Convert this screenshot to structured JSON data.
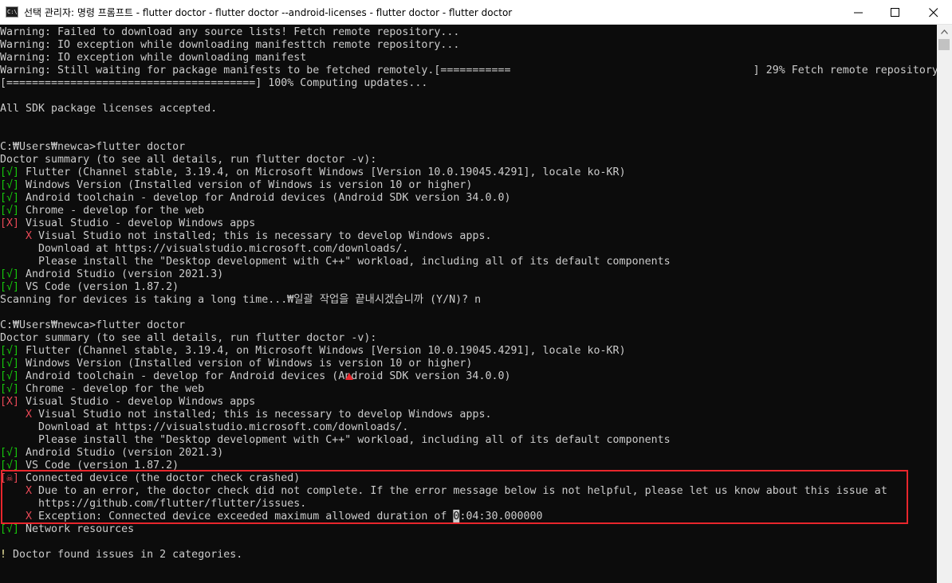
{
  "window": {
    "title": "선택 관리자: 명령 프롬프트 - flutter  doctor - flutter  doctor --android-licenses - flutter  doctor - flutter  doctor",
    "app_icon_text": "C:\\"
  },
  "lines": [
    {
      "segs": [
        {
          "t": "Warning: Failed to download any source lists! Fetch remote repository...",
          "c": ""
        }
      ]
    },
    {
      "segs": [
        {
          "t": "Warning: IO exception while downloading manifesttch remote repository...",
          "c": ""
        }
      ]
    },
    {
      "segs": [
        {
          "t": "Warning: IO exception while downloading manifest",
          "c": ""
        }
      ]
    },
    {
      "segs": [
        {
          "t": "Warning: Still waiting for package manifests to be fetched remotely.[===========                                      ] 29% Fetch remote repository...",
          "c": ""
        }
      ]
    },
    {
      "segs": [
        {
          "t": "[=======================================] 100% Computing updates...",
          "c": ""
        }
      ]
    },
    {
      "segs": []
    },
    {
      "segs": [
        {
          "t": "All SDK package licenses accepted.",
          "c": ""
        }
      ]
    },
    {
      "segs": []
    },
    {
      "segs": []
    },
    {
      "segs": [
        {
          "t": "C:₩Users₩newca>flutter doctor",
          "c": ""
        }
      ]
    },
    {
      "segs": [
        {
          "t": "Doctor summary (to see all details, run flutter doctor -v):",
          "c": ""
        }
      ]
    },
    {
      "segs": [
        {
          "t": "[√]",
          "c": "g"
        },
        {
          "t": " Flutter (Channel stable, 3.19.4, on Microsoft Windows [Version 10.0.19045.4291], locale ko-KR)",
          "c": ""
        }
      ]
    },
    {
      "segs": [
        {
          "t": "[√]",
          "c": "g"
        },
        {
          "t": " Windows Version (Installed version of Windows is version 10 or higher)",
          "c": ""
        }
      ]
    },
    {
      "segs": [
        {
          "t": "[√]",
          "c": "g"
        },
        {
          "t": " Android toolchain - develop for Android devices (Android SDK version 34.0.0)",
          "c": ""
        }
      ]
    },
    {
      "segs": [
        {
          "t": "[√]",
          "c": "g"
        },
        {
          "t": " Chrome - develop for the web",
          "c": ""
        }
      ]
    },
    {
      "segs": [
        {
          "t": "[X]",
          "c": "r"
        },
        {
          "t": " Visual Studio - develop Windows apps",
          "c": ""
        }
      ]
    },
    {
      "segs": [
        {
          "t": "    ",
          "c": ""
        },
        {
          "t": "X",
          "c": "r"
        },
        {
          "t": " Visual Studio not installed; this is necessary to develop Windows apps.",
          "c": ""
        }
      ]
    },
    {
      "segs": [
        {
          "t": "      Download at https://visualstudio.microsoft.com/downloads/.",
          "c": ""
        }
      ]
    },
    {
      "segs": [
        {
          "t": "      Please install the \"Desktop development with C++\" workload, including all of its default components",
          "c": ""
        }
      ]
    },
    {
      "segs": [
        {
          "t": "[√]",
          "c": "g"
        },
        {
          "t": " Android Studio (version 2021.3)",
          "c": ""
        }
      ]
    },
    {
      "segs": [
        {
          "t": "[√]",
          "c": "g"
        },
        {
          "t": " VS Code (version 1.87.2)",
          "c": ""
        }
      ]
    },
    {
      "segs": [
        {
          "t": "Scanning for devices is taking a long time...₩일괄 작업을 끝내시겠습니까 (Y/N)? n",
          "c": ""
        }
      ]
    },
    {
      "segs": []
    },
    {
      "segs": [
        {
          "t": "C:₩Users₩newca>flutter doctor",
          "c": ""
        }
      ]
    },
    {
      "segs": [
        {
          "t": "Doctor summary (to see all details, run flutter doctor -v):",
          "c": ""
        }
      ]
    },
    {
      "segs": [
        {
          "t": "[√]",
          "c": "g"
        },
        {
          "t": " Flutter (Channel stable, 3.19.4, on Microsoft Windows [Version 10.0.19045.4291], locale ko-KR)",
          "c": ""
        }
      ]
    },
    {
      "segs": [
        {
          "t": "[√]",
          "c": "g"
        },
        {
          "t": " Windows Version (Installed version of Windows is version 10 or higher)",
          "c": ""
        }
      ]
    },
    {
      "segs": [
        {
          "t": "[√]",
          "c": "g"
        },
        {
          "t": " Android toolchain - develop for Android devices (Android SDK version 34.0.0)",
          "c": ""
        }
      ]
    },
    {
      "segs": [
        {
          "t": "[√]",
          "c": "g"
        },
        {
          "t": " Chrome - develop for the web",
          "c": ""
        }
      ]
    },
    {
      "segs": [
        {
          "t": "[X]",
          "c": "r"
        },
        {
          "t": " Visual Studio - develop Windows apps",
          "c": ""
        }
      ]
    },
    {
      "segs": [
        {
          "t": "    ",
          "c": ""
        },
        {
          "t": "X",
          "c": "r"
        },
        {
          "t": " Visual Studio not installed; this is necessary to develop Windows apps.",
          "c": ""
        }
      ]
    },
    {
      "segs": [
        {
          "t": "      Download at https://visualstudio.microsoft.com/downloads/.",
          "c": ""
        }
      ]
    },
    {
      "segs": [
        {
          "t": "      Please install the \"Desktop development with C++\" workload, including all of its default components",
          "c": ""
        }
      ]
    },
    {
      "segs": [
        {
          "t": "[√]",
          "c": "g"
        },
        {
          "t": " Android Studio (version 2021.3)",
          "c": ""
        }
      ]
    },
    {
      "segs": [
        {
          "t": "[√]",
          "c": "g"
        },
        {
          "t": " VS Code (version 1.87.2)",
          "c": ""
        }
      ]
    },
    {
      "segs": [
        {
          "t": "[☠]",
          "c": "r"
        },
        {
          "t": " Connected device (the doctor check crashed)",
          "c": ""
        }
      ]
    },
    {
      "segs": [
        {
          "t": "    ",
          "c": ""
        },
        {
          "t": "X",
          "c": "r"
        },
        {
          "t": " Due to an error, the doctor check did not complete. If the error message below is not helpful, please let us know about this issue at",
          "c": ""
        }
      ]
    },
    {
      "segs": [
        {
          "t": "      https://github.com/flutter/flutter/issues.",
          "c": ""
        }
      ]
    },
    {
      "segs": [
        {
          "t": "    ",
          "c": ""
        },
        {
          "t": "X",
          "c": "r"
        },
        {
          "t": " Exception: Connected device exceeded maximum allowed duration of ",
          "c": ""
        },
        {
          "t": "0",
          "c": "cursor"
        },
        {
          "t": ":04:30.000000",
          "c": ""
        }
      ]
    },
    {
      "segs": [
        {
          "t": "[√]",
          "c": "g"
        },
        {
          "t": " Network resources",
          "c": ""
        }
      ]
    },
    {
      "segs": []
    },
    {
      "segs": [
        {
          "t": "!",
          "c": "y"
        },
        {
          "t": " Doctor found issues in 2 categories.",
          "c": ""
        }
      ]
    }
  ],
  "colors": {
    "background": "#0c0c0c",
    "text": "#cccccc",
    "ok_green": "#16c60c",
    "error_red": "#e74856",
    "warn_yellow": "#f9f1a5",
    "annotation_red": "#e8262c"
  },
  "icons": {
    "minimize": "minimize-icon",
    "maximize": "maximize-icon",
    "close": "close-icon",
    "scroll_up": "chevron-up-icon"
  }
}
